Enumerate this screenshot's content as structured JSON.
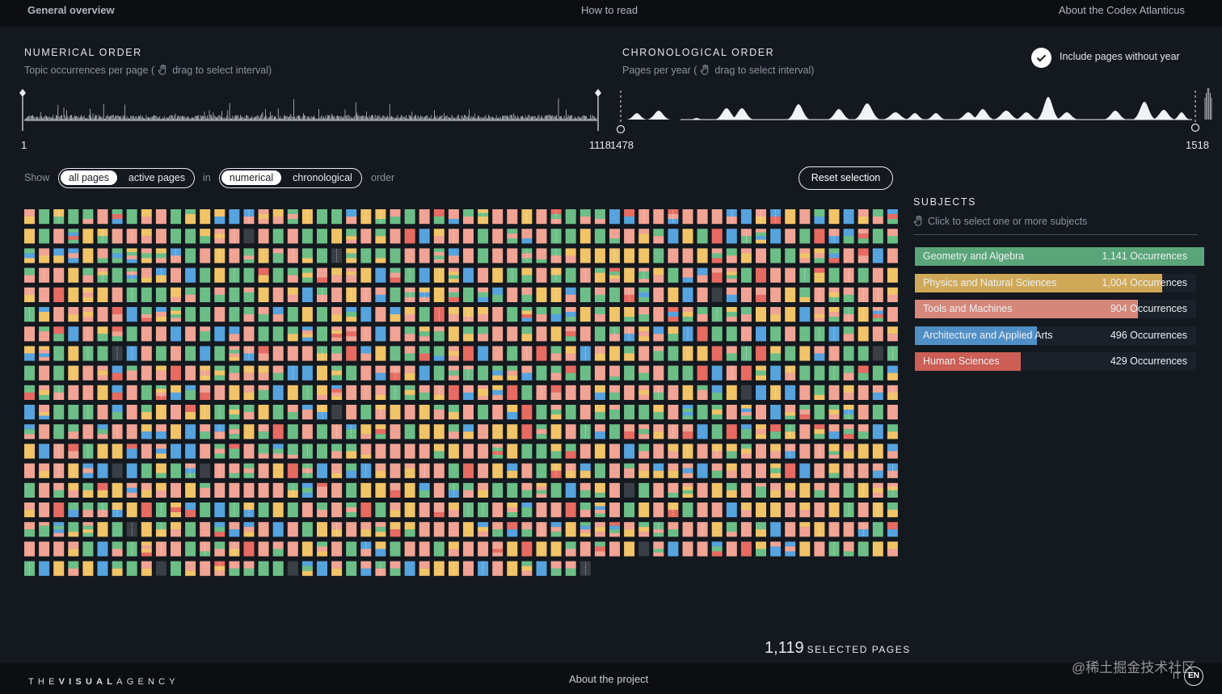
{
  "nav": {
    "general": "General overview",
    "how": "How to read",
    "about": "About the Codex Atlanticus"
  },
  "numerical": {
    "title": "NUMERICAL ORDER",
    "sub_a": "Topic occurrences per page (",
    "sub_b": "drag to select interval)",
    "start": "1",
    "end": "1118"
  },
  "chronological": {
    "title": "CHRONOLOGICAL ORDER",
    "sub_a": "Pages per year (",
    "sub_b": "drag to select interval)",
    "start": "1478",
    "end": "1518"
  },
  "include_label": "Include pages without year",
  "controls": {
    "show": "Show",
    "all_pages": "all pages",
    "active_pages": "active pages",
    "in": "in",
    "numerical": "numerical",
    "chronological": "chronological",
    "order": "order",
    "reset": "Reset selection"
  },
  "subjects": {
    "title": "SUBJECTS",
    "sub": "Click to select one or more subjects",
    "items": [
      {
        "name": "Geometry and Algebra",
        "occ": "1,141 Occurrences",
        "count": 1141,
        "color": "#5aa579"
      },
      {
        "name": "Physics and Natural Sciences",
        "occ": "1,004 Occurrences",
        "count": 1004,
        "color": "#cfa957"
      },
      {
        "name": "Tools and Machines",
        "occ": "904 Occurrences",
        "count": 904,
        "color": "#d5887a"
      },
      {
        "name": "Architecture and Applied Arts",
        "occ": "496 Occurrences",
        "count": 496,
        "color": "#4f8fc6"
      },
      {
        "name": "Human Sciences",
        "occ": "429 Occurrences",
        "count": 429,
        "color": "#cc5e55"
      }
    ]
  },
  "colors": {
    "geometry": "#6bbf86",
    "physics": "#f2c466",
    "tools": "#f2a393",
    "architecture": "#55a3df",
    "human": "#e86a60",
    "none": "#3a3f47",
    "background": "#14181f"
  },
  "selected": {
    "num": "1,119",
    "label": "SELECTED PAGES"
  },
  "footer": {
    "brand_a": "THE",
    "brand_b": "VISUAL",
    "brand_c": "AGENCY",
    "about": "About the project",
    "watermark": "@稀土掘金技术社区",
    "lang_it": "IT",
    "lang_en": "EN"
  }
}
